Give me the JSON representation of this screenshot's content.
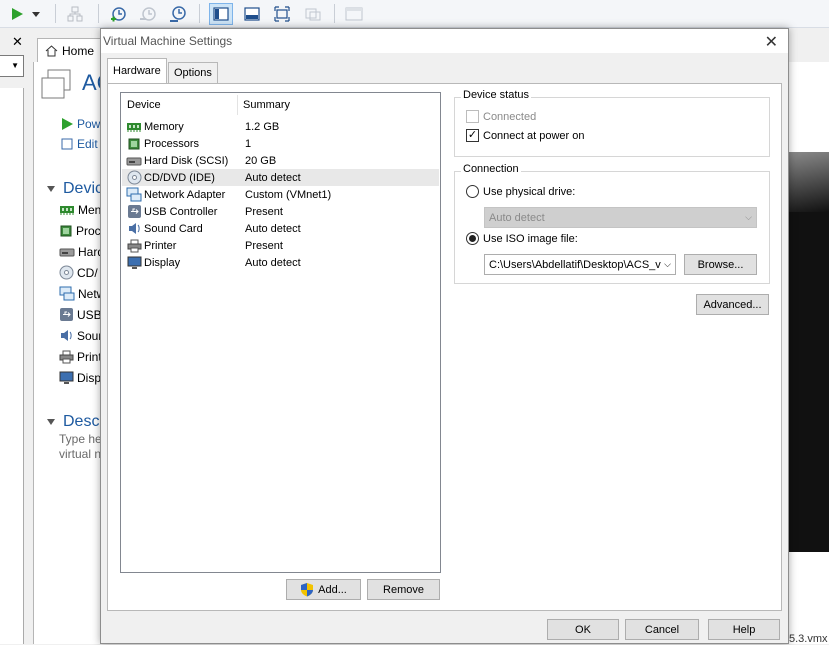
{
  "background": {
    "home_tab": "Home",
    "vm_title": "AC",
    "actions": [
      "Pow",
      "Edit"
    ],
    "devices_section": "Device",
    "devices": [
      {
        "label": "Men",
        "icon": "memory-icon"
      },
      {
        "label": "Proc",
        "icon": "processor-icon"
      },
      {
        "label": "Hard",
        "icon": "hard-disk-icon"
      },
      {
        "label": "CD/",
        "icon": "cd-dvd-icon"
      },
      {
        "label": "Netw",
        "icon": "network-adapter-icon"
      },
      {
        "label": "USB",
        "icon": "usb-controller-icon"
      },
      {
        "label": "Sour",
        "icon": "sound-card-icon"
      },
      {
        "label": "Print",
        "icon": "printer-icon"
      },
      {
        "label": "Disp",
        "icon": "display-icon"
      }
    ],
    "description_section": "Descri",
    "description_lines": [
      "Type he",
      "virtual n"
    ],
    "file_text": "5.3.vmx"
  },
  "dialog": {
    "title": "Virtual Machine Settings",
    "tabs": [
      {
        "label": "Hardware",
        "active": true
      },
      {
        "label": "Options",
        "active": false
      }
    ],
    "columns": {
      "device": "Device",
      "summary": "Summary"
    },
    "devices": [
      {
        "device": "Memory",
        "summary": "1.2 GB",
        "icon": "memory-icon"
      },
      {
        "device": "Processors",
        "summary": "1",
        "icon": "processor-icon"
      },
      {
        "device": "Hard Disk (SCSI)",
        "summary": "20 GB",
        "icon": "hard-disk-icon"
      },
      {
        "device": "CD/DVD (IDE)",
        "summary": "Auto detect",
        "icon": "cd-dvd-icon",
        "selected": true
      },
      {
        "device": "Network Adapter",
        "summary": "Custom (VMnet1)",
        "icon": "network-adapter-icon"
      },
      {
        "device": "USB Controller",
        "summary": "Present",
        "icon": "usb-controller-icon"
      },
      {
        "device": "Sound Card",
        "summary": "Auto detect",
        "icon": "sound-card-icon"
      },
      {
        "device": "Printer",
        "summary": "Present",
        "icon": "printer-icon"
      },
      {
        "device": "Display",
        "summary": "Auto detect",
        "icon": "display-icon"
      }
    ],
    "add_button": "Add...",
    "remove_button": "Remove",
    "device_status": {
      "legend": "Device status",
      "connected_label": "Connected",
      "connected_checked": false,
      "connected_enabled": false,
      "power_on_label": "Connect at power on",
      "power_on_checked": true
    },
    "connection": {
      "legend": "Connection",
      "physical_label": "Use physical drive:",
      "physical_value": "Auto detect",
      "iso_label": "Use ISO image file:",
      "iso_value": "C:\\Users\\Abdellatif\\Desktop\\ACS_v",
      "selected": "iso",
      "browse_button": "Browse..."
    },
    "advanced_button": "Advanced...",
    "ok_button": "OK",
    "cancel_button": "Cancel",
    "help_button": "Help"
  },
  "colors": {
    "link_blue": "#1e5aa0",
    "selection": "#e8e8e8",
    "dialog_bg": "#f0f0f0"
  }
}
